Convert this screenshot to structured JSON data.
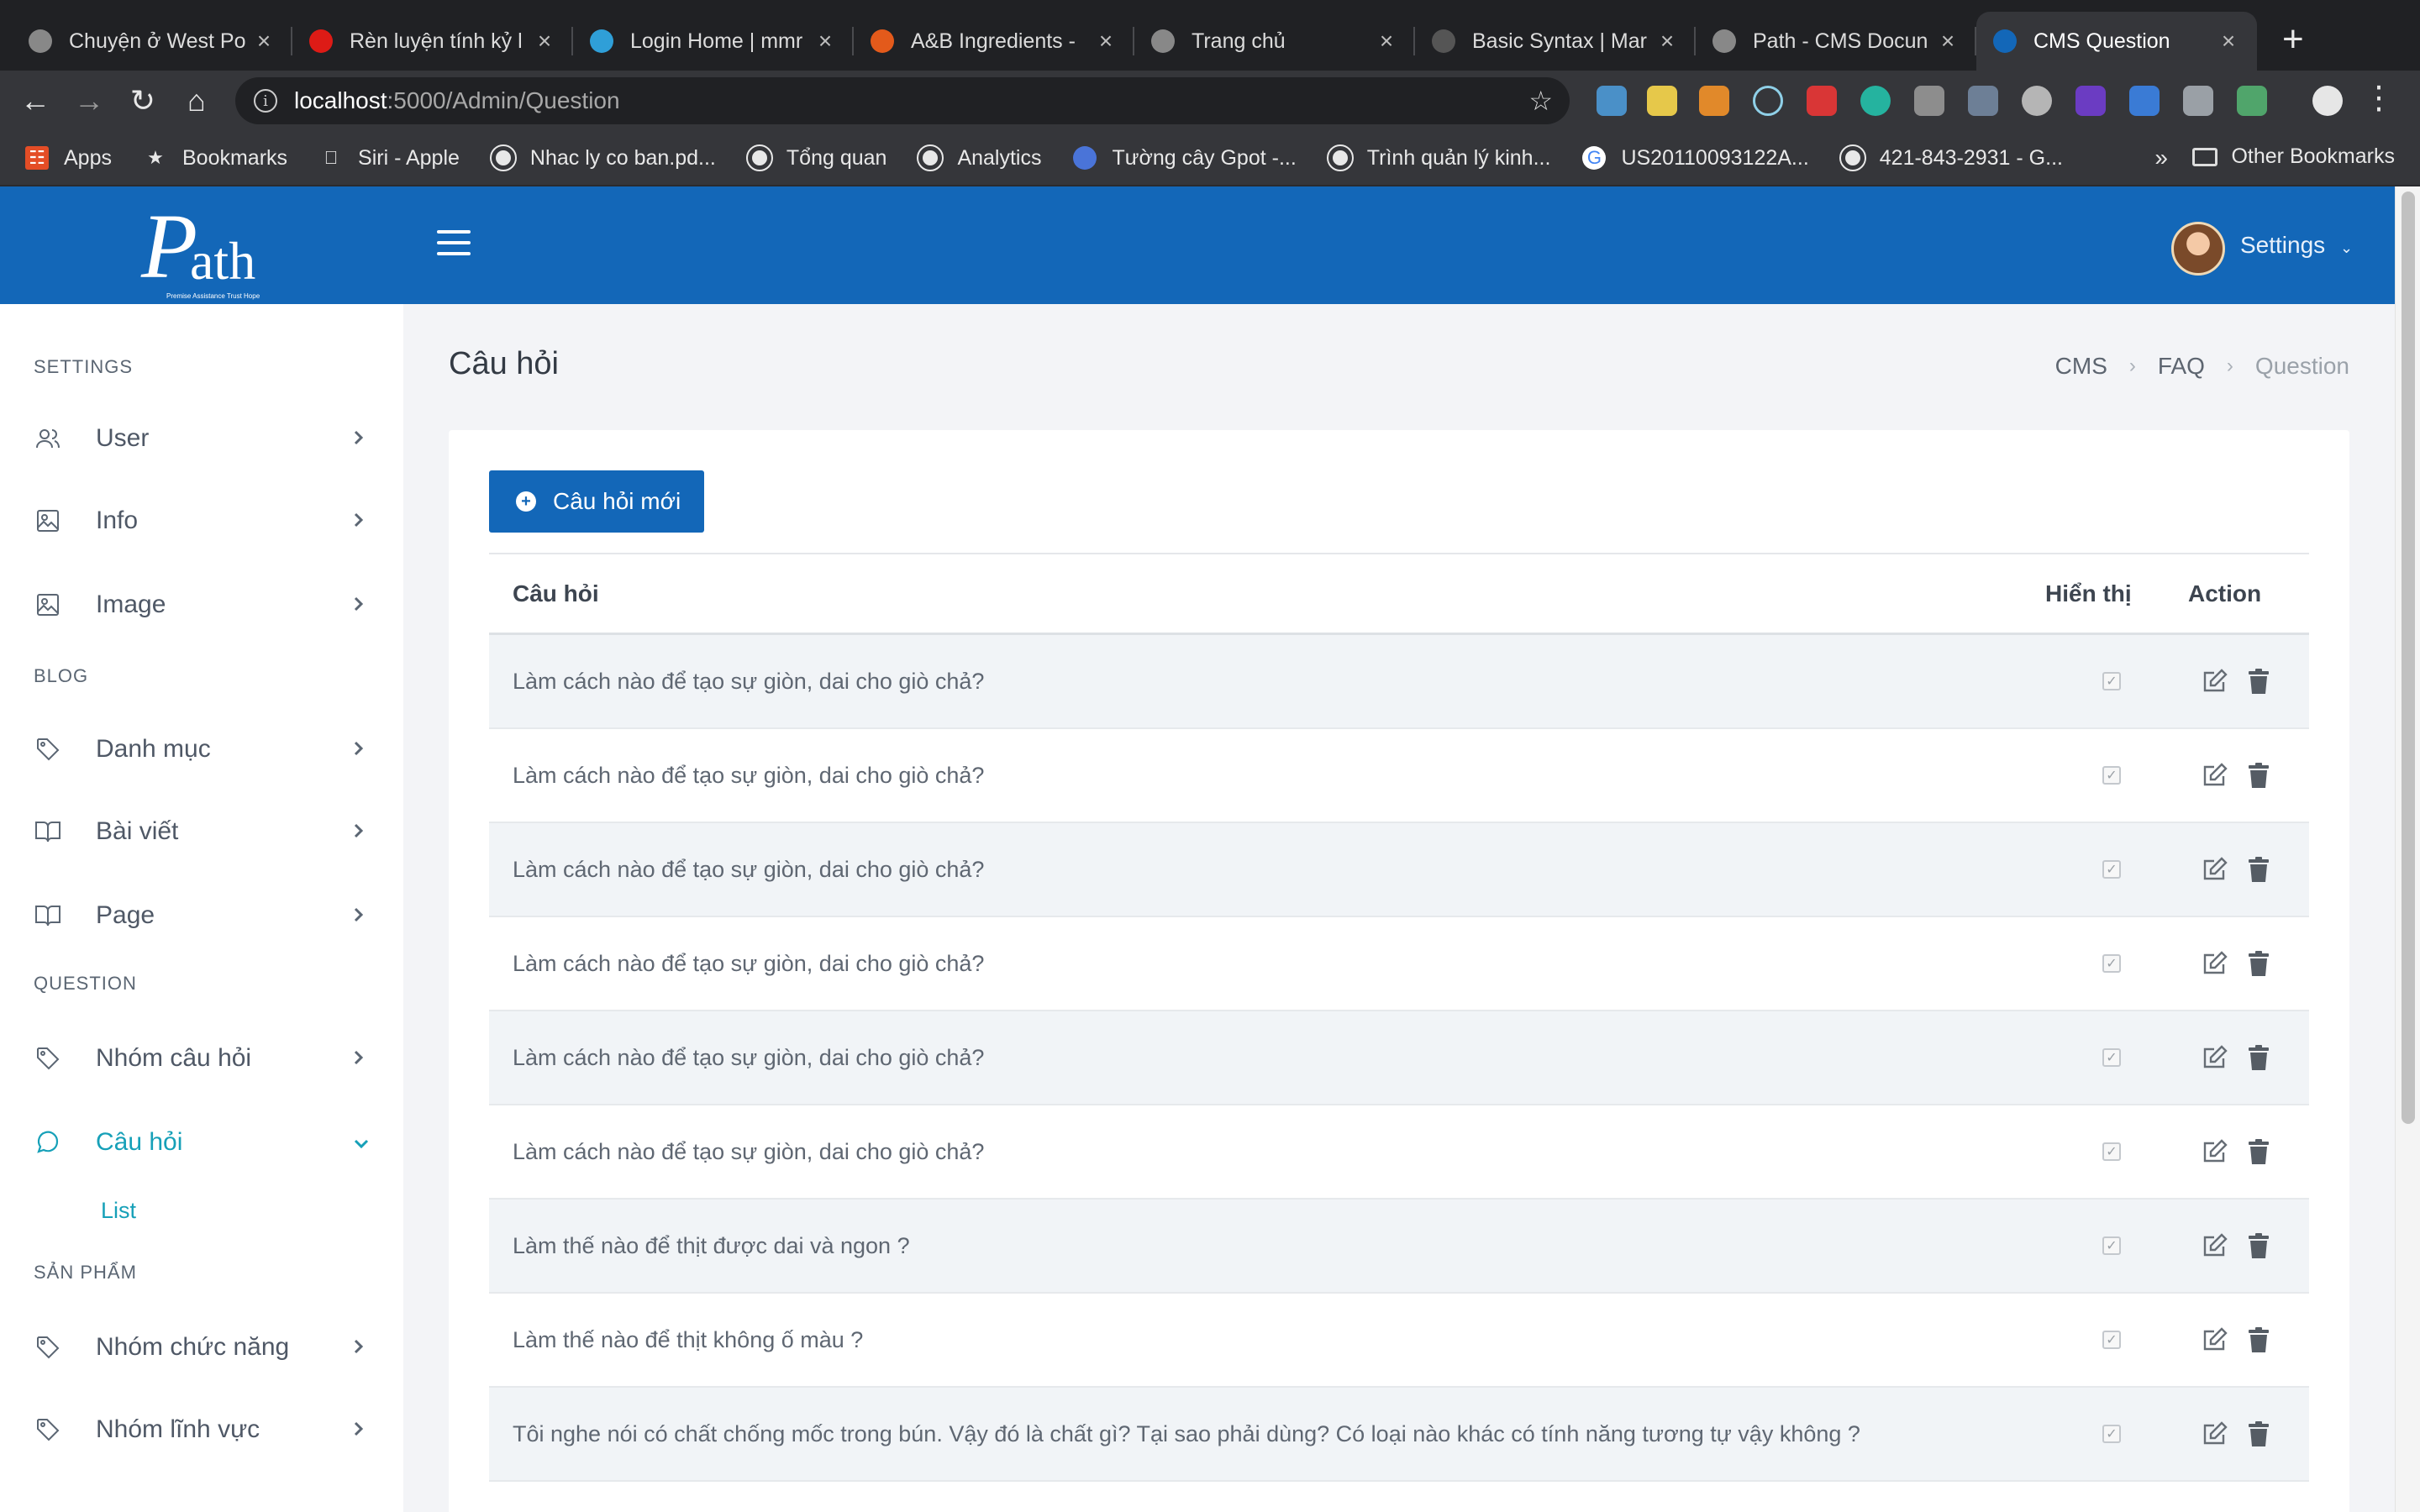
{
  "browser": {
    "tabs": [
      {
        "title": "Chuyện ở West Po",
        "icon": "globe-icon",
        "color": "#888888",
        "active": false
      },
      {
        "title": "Rèn luyện tính kỷ l",
        "icon": "angular-icon",
        "color": "#dd1b16",
        "active": false
      },
      {
        "title": "Login Home | mmr",
        "icon": "play-icon",
        "color": "#2f9fd8",
        "active": false
      },
      {
        "title": "A&B Ingredients -",
        "icon": "angular-icon",
        "color": "#e35a1b",
        "active": false
      },
      {
        "title": "Trang chủ",
        "icon": "globe-icon",
        "color": "#888888",
        "active": false
      },
      {
        "title": "Basic Syntax | Mar",
        "icon": "markdown-icon",
        "color": "#555555",
        "active": false
      },
      {
        "title": "Path - CMS Docun",
        "icon": "globe-icon",
        "color": "#888888",
        "active": false
      },
      {
        "title": "CMS Question",
        "icon": "path-logo-icon",
        "color": "#1367b8",
        "active": true
      }
    ],
    "url_host": "localhost",
    "url_path": ":5000/Admin/Question",
    "bookmarks": [
      {
        "label": "Apps",
        "icon": "apps-grid-icon"
      },
      {
        "label": "Bookmarks",
        "icon": "star-icon"
      },
      {
        "label": "Siri - Apple",
        "icon": "apple-icon"
      },
      {
        "label": "Nhac ly co ban.pd...",
        "icon": "globe-icon"
      },
      {
        "label": "Tổng quan",
        "icon": "globe-icon"
      },
      {
        "label": "Analytics",
        "icon": "globe-icon"
      },
      {
        "label": "Tường cây Gpot -...",
        "icon": "gpot-icon"
      },
      {
        "label": "Trình quản lý kinh...",
        "icon": "globe-icon"
      },
      {
        "label": "US20110093122A...",
        "icon": "google-icon"
      },
      {
        "label": "421-843-2931 - G...",
        "icon": "globe-icon"
      }
    ],
    "bookmarks_more": "»",
    "other_bookmarks": "Other Bookmarks"
  },
  "header": {
    "logo_letter": "P",
    "logo_rest": "ath",
    "logo_tagline": "Premise Assistance Trust Hope",
    "settings_label": "Settings",
    "brand_color": "#1367b8"
  },
  "sidebar": {
    "sections": [
      {
        "title": "SETTINGS"
      },
      {
        "title": "BLOG"
      },
      {
        "title": "QUESTION"
      },
      {
        "title": "SẢN PHẨM"
      }
    ],
    "items": [
      {
        "label": "User",
        "icon": "user-icon"
      },
      {
        "label": "Info",
        "icon": "image-icon"
      },
      {
        "label": "Image",
        "icon": "image-icon"
      },
      {
        "label": "Danh mục",
        "icon": "tag-icon"
      },
      {
        "label": "Bài viết",
        "icon": "book-icon"
      },
      {
        "label": "Page",
        "icon": "book-icon"
      },
      {
        "label": "Nhóm câu hỏi",
        "icon": "tag-icon"
      },
      {
        "label": "Câu hỏi",
        "icon": "chat-icon",
        "active": true
      },
      {
        "label": "Nhóm chức năng",
        "icon": "tag-icon"
      },
      {
        "label": "Nhóm lĩnh vực",
        "icon": "tag-icon"
      }
    ],
    "sub_list": "List",
    "accent_color": "#16a0b8"
  },
  "page": {
    "title": "Câu hỏi",
    "breadcrumb": [
      "CMS",
      "FAQ",
      "Question"
    ],
    "new_button": "Câu hỏi mới"
  },
  "table": {
    "columns": [
      "Câu hỏi",
      "Hiển thị",
      "Action"
    ],
    "rows": [
      {
        "question": "Làm cách nào để tạo sự giòn, dai cho giò chả?",
        "visible": true
      },
      {
        "question": "Làm cách nào để tạo sự giòn, dai cho giò chả?",
        "visible": true
      },
      {
        "question": "Làm cách nào để tạo sự giòn, dai cho giò chả?",
        "visible": true
      },
      {
        "question": "Làm cách nào để tạo sự giòn, dai cho giò chả?",
        "visible": true
      },
      {
        "question": "Làm cách nào để tạo sự giòn, dai cho giò chả?",
        "visible": true
      },
      {
        "question": "Làm cách nào để tạo sự giòn, dai cho giò chả?",
        "visible": true
      },
      {
        "question": "Làm thế nào để thịt được dai và ngon ?",
        "visible": true
      },
      {
        "question": "Làm thế nào để thịt không ố màu ?",
        "visible": true
      },
      {
        "question": "Tôi nghe nói có chất chống mốc trong bún. Vậy đó là chất gì? Tại sao phải dùng? Có loại nào khác có tính năng tương tự vậy không ?",
        "visible": true
      }
    ]
  }
}
